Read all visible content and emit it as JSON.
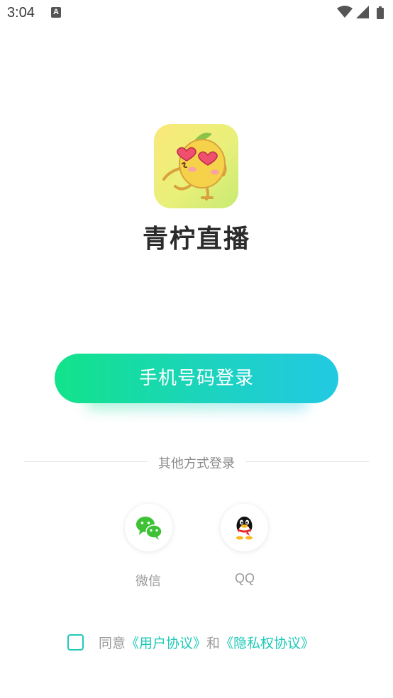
{
  "status_bar": {
    "time": "3:04",
    "notification_letter": "A"
  },
  "app": {
    "name": "青柠直播"
  },
  "login": {
    "phone_button_label": "手机号码登录"
  },
  "other_login": {
    "title": "其他方式登录",
    "options": [
      {
        "label": "微信",
        "icon": "wechat-icon"
      },
      {
        "label": "QQ",
        "icon": "qq-icon"
      }
    ]
  },
  "agreement": {
    "prefix": "同意",
    "user_agreement": "《用户协议》",
    "conjunction": "和",
    "privacy_agreement": "《隐私权协议》",
    "checked": false
  },
  "colors": {
    "accent": "#1fc9b8",
    "button_gradient_start": "#12e38a",
    "button_gradient_end": "#22c9e2",
    "logo_background": "#fbe97a"
  }
}
